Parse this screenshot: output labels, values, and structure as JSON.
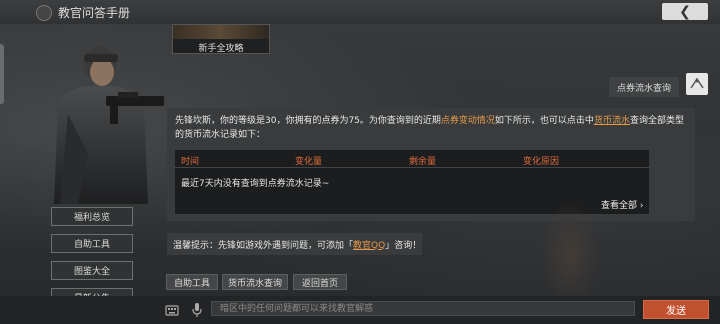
{
  "header": {
    "title": "教官问答手册"
  },
  "left_menu": {
    "items": [
      "福利总览",
      "自助工具",
      "图鉴大全",
      "最新公告"
    ]
  },
  "guide_card": {
    "label": "新手全攻略"
  },
  "user_message": {
    "text": "点券流水查询"
  },
  "answer": {
    "line_a": "先锋坎斯，你的等级是30，你拥有的点券为75。为你查询到的近期",
    "link1": "点券变动情况",
    "line_b": "如下所示，也可以点击中",
    "link2": "货币流水",
    "line_c": "查询全部类型的货币流水记录如下：",
    "table": {
      "headers": [
        "时间",
        "变化量",
        "剩余量",
        "变化原因"
      ],
      "empty_text": "最近7天内没有查询到点券流水记录~",
      "view_all": "查看全部"
    }
  },
  "tip": {
    "prefix": "温馨提示：先锋如游戏外遇到问题，可添加「",
    "link": "教官QQ",
    "suffix": "」咨询！"
  },
  "quick_buttons": [
    "自助工具",
    "货币流水查询",
    "返回首页"
  ],
  "input": {
    "placeholder": "暗区中的任何问题都可以来找教官解惑"
  },
  "send_label": "发送",
  "colors": {
    "accent": "#e39a4a",
    "table_header": "#e06a3c",
    "send_button": "#c0502e"
  }
}
